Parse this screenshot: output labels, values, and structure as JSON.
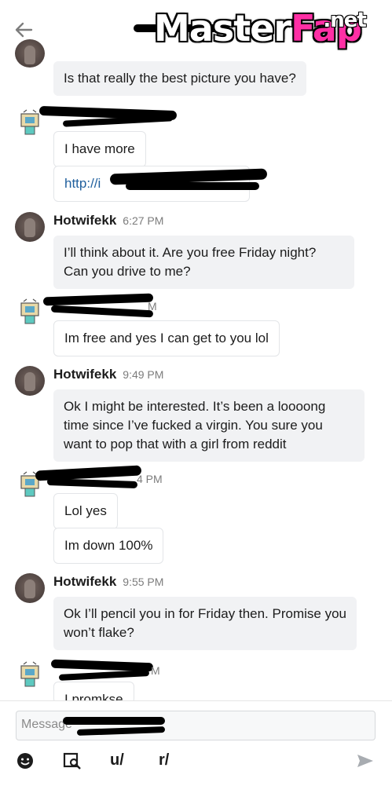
{
  "header": {
    "back_icon": "arrow-left-icon",
    "watermark": {
      "main": "Master",
      "accent": "Fap",
      "suffix": ".net"
    }
  },
  "messages": [
    {
      "kind": "bubble",
      "text": "Is that really the best picture you have?"
    },
    {
      "kind": "bubble",
      "text": "I have more"
    },
    {
      "kind": "link",
      "text": "http://i"
    },
    {
      "kind": "header",
      "author": "Hotwifekk",
      "time": "6:27 PM"
    },
    {
      "kind": "bubble",
      "text": "I’ll think about it. Are you free Friday night? Can you drive to me?"
    },
    {
      "kind": "header",
      "time_fragment": "M"
    },
    {
      "kind": "bubble",
      "text": "Im free and yes I can get to you lol"
    },
    {
      "kind": "header",
      "author": "Hotwifekk",
      "time": "9:49 PM"
    },
    {
      "kind": "bubble",
      "text": "Ok I might be interested. It’s been a loooong time since I’ve fucked a virgin. You sure you want to pop that with a girl from reddit"
    },
    {
      "kind": "header",
      "time_fragment": "4 PM"
    },
    {
      "kind": "bubble",
      "text": "Lol yes"
    },
    {
      "kind": "bubble",
      "text": "Im down 100%"
    },
    {
      "kind": "header",
      "author": "Hotwifekk",
      "time": "9:55 PM"
    },
    {
      "kind": "bubble",
      "text": "Ok I’ll pencil you in for Friday then. Promise you won’t flake?"
    },
    {
      "kind": "header",
      "time_fragment": "M"
    },
    {
      "kind": "bubble",
      "text": "I promkse"
    }
  ],
  "composer": {
    "placeholder": "Message",
    "tools": {
      "emoji_icon": "emoji-icon",
      "image_search_icon": "image-search-icon",
      "user_prefix": "u/",
      "subreddit_prefix": "r/",
      "send_icon": "send-icon"
    }
  },
  "colors": {
    "bubble": "#f1f2f4",
    "link": "#1f5f9d",
    "watermark_accent": "#ff2fa5"
  }
}
